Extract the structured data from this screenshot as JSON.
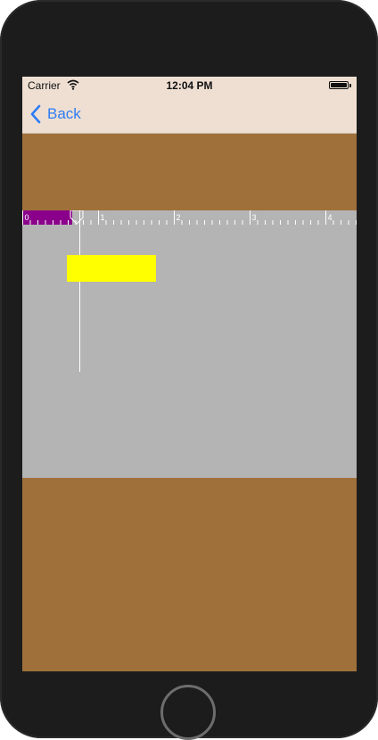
{
  "status_bar": {
    "carrier": "Carrier",
    "time": "12:04 PM",
    "wifi_icon": "wifi-icon",
    "battery_icon": "battery-icon"
  },
  "nav": {
    "back_label": "Back",
    "back_icon": "chevron-left-icon",
    "tint_color": "#2f7cf6",
    "background_color": "#eedfd2"
  },
  "ruler": {
    "labels": [
      "0",
      "1",
      "2",
      "3",
      "4"
    ],
    "progress_value": 0.68,
    "progress_color": "#8b008b",
    "background_color": "#b4b4b4"
  },
  "colors": {
    "content_background": "#a0703a",
    "canvas_background": "#b4b4b4",
    "highlight_box": "#ffff00",
    "guide_line": "#ffffff"
  }
}
